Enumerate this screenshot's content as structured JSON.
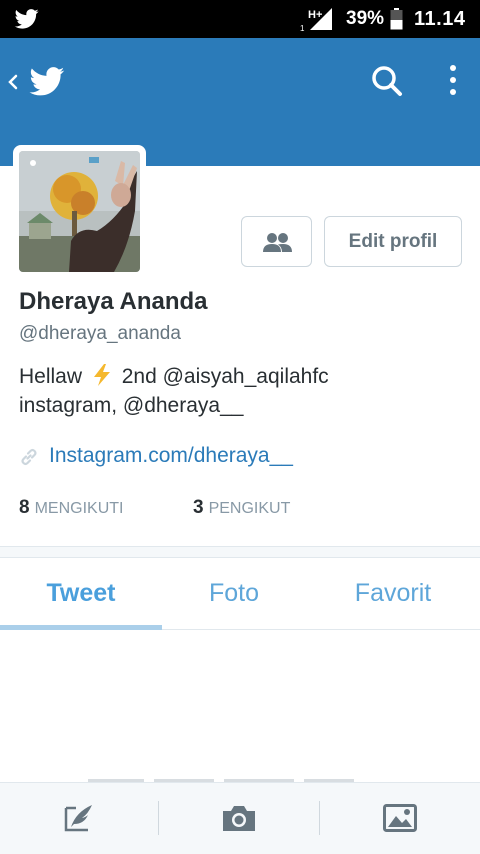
{
  "status_bar": {
    "network": "H+",
    "sim": "1",
    "battery_percent": "39%",
    "time": "11.14"
  },
  "header": {
    "back_icon": "back-chevron-icon",
    "logo_icon": "twitter-bird-icon",
    "search_icon": "search-icon",
    "menu_icon": "overflow-menu-icon",
    "banner_color": "#2b7bb9"
  },
  "profile": {
    "name": "Dheraya Ananda",
    "handle": "@dheraya_ananda",
    "bio_line1_before": "Hellaw",
    "bio_line1_after": "2nd @aisyah_aqilahfc",
    "bio_line2": "instagram, @dheraya__",
    "link": "Instagram.com/dheraya__",
    "edit_button": "Edit profil",
    "following_count": "8",
    "following_label": "MENGIKUTI",
    "followers_count": "3",
    "followers_label": "PENGIKUT"
  },
  "tabs": [
    {
      "label": "Tweet",
      "active": true
    },
    {
      "label": "Foto",
      "active": false
    },
    {
      "label": "Favorit",
      "active": false
    }
  ],
  "bottom_bar": {
    "compose_icon": "compose-tweet-icon",
    "camera_icon": "camera-icon",
    "gallery_icon": "photo-gallery-icon"
  },
  "colors": {
    "accent": "#2b7bb9",
    "tab_text": "#5ea6d9",
    "link": "#2b7bb9"
  }
}
